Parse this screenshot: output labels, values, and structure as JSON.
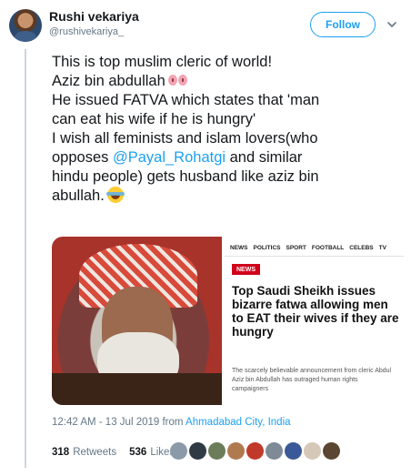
{
  "author": {
    "name": "Rushi vekariya",
    "handle": "@rushivekariya_"
  },
  "follow_label": "Follow",
  "tweet": {
    "line1": "This is top muslim cleric of world!",
    "line2": "Aziz bin abdullah",
    "line3": "He issued FATVA which states that 'man",
    "line4": "can eat his wife if he is hungry'",
    "line5": "I wish all feminists and islam lovers(who",
    "line6_pre": "opposes ",
    "mention": "@Payal_Rohatgi",
    "line6_post": " and similar",
    "line7": "hindu people) gets husband like aziz bin",
    "line8": "abullah."
  },
  "article": {
    "nav": [
      "NEWS",
      "POLITICS",
      "SPORT",
      "FOOTBALL",
      "CELEBS",
      "TV"
    ],
    "badge": "NEWS",
    "headline": "Top Saudi Sheikh issues bizarre fatwa allowing men to EAT their wives if they are hungry",
    "subtext": "The scarcely believable announcement from cleric Abdul Aziz bin Abdullah has outraged human rights campaigners"
  },
  "timestamp": {
    "time": "12:42 AM - 13 Jul 2019 from ",
    "place": "Ahmadabad City, India"
  },
  "stats": {
    "retweets_count": "318",
    "retweets_label": "Retweets",
    "likes_count": "536",
    "likes_label": "Likes"
  },
  "liker_avatars": [
    "#8a9aa8",
    "#2f3a44",
    "#6b7c5a",
    "#b07a4f",
    "#c0392b",
    "#7e8a96",
    "#3b5998",
    "#d6c8b8",
    "#5a4632"
  ],
  "colors": {
    "accent": "#1da1f2",
    "text": "#14171a",
    "muted": "#657786",
    "news_red": "#d0021b"
  }
}
